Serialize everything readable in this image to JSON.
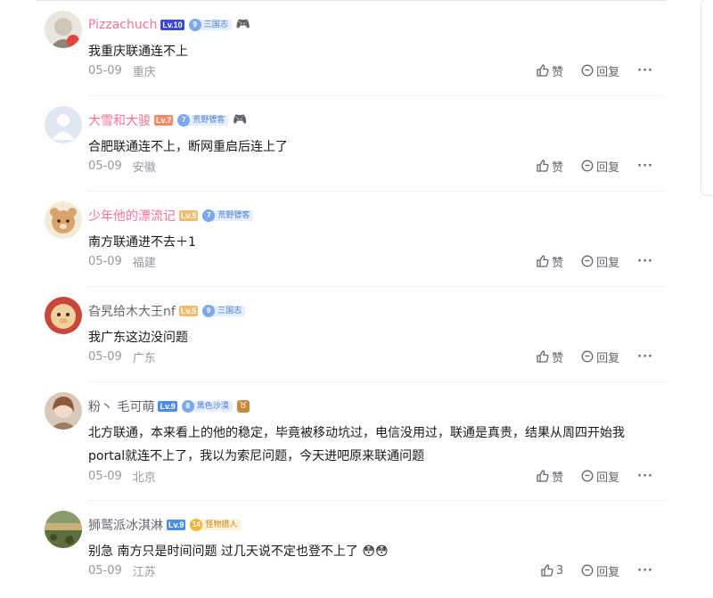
{
  "actions": {
    "like_label": "赞",
    "reply_label": "回复",
    "more_label": "···"
  },
  "colors": {
    "vip_name": "#fb7299",
    "name": "#61666d",
    "meta": "#9499a0",
    "text": "#18191c"
  },
  "comments": [
    {
      "username": "Pizzachuch",
      "vip": true,
      "level": "Lv.10",
      "level_color": "#3b4acf",
      "fan_level": "9",
      "fan_name": "三国志",
      "emblem": "game-icon",
      "text": "我重庆联通连不上",
      "date": "05-09",
      "location": "重庆",
      "likes": ""
    },
    {
      "username": "大雪和大骏",
      "vip": true,
      "level": "Lv.7",
      "level_color": "#f58b6a",
      "fan_level": "7",
      "fan_name": "荒野镖客",
      "emblem": "game-icon",
      "text": "合肥联通连不上，断网重启后连上了",
      "date": "05-09",
      "location": "安徽",
      "likes": ""
    },
    {
      "username": "少年他的漂流记",
      "vip": true,
      "level": "Lv.5",
      "level_color": "#f4ba6e",
      "fan_level": "7",
      "fan_name": "荒野镖客",
      "emblem": "",
      "text": "南方联通进不去＋1",
      "date": "05-09",
      "location": "福建",
      "likes": ""
    },
    {
      "username": "旮旯给木大王nf",
      "vip": true,
      "level": "Lv.5",
      "level_color": "#f4ba6e",
      "fan_level": "9",
      "fan_name": "三国志",
      "emblem": "",
      "text": "我广东这边没问题",
      "date": "05-09",
      "location": "广东",
      "likes": ""
    },
    {
      "username": "粉丶 毛可萌",
      "vip": false,
      "level": "Lv.9",
      "level_color": "#4c8ee6",
      "fan_level": "8",
      "fan_name": "黑色沙漠",
      "emblem": "badge-icon",
      "text": "北方联通，本来看上的他的稳定，毕竟被移动坑过，电信没用过，联通是真贵，结果从周四开始我portal就连不上了，我以为索尼问题，今天进吧原来联通问题",
      "date": "05-09",
      "location": "北京",
      "likes": ""
    },
    {
      "username": "狮鹫派冰淇淋",
      "vip": false,
      "level": "Lv.9",
      "level_color": "#4c8ee6",
      "fan_level": "14",
      "fan_name": "怪物猎人",
      "emblem": "",
      "text": "别急 南方只是时间问题 过几天说不定也登不上了 😳😳",
      "date": "05-09",
      "location": "江苏",
      "likes": "3"
    }
  ]
}
